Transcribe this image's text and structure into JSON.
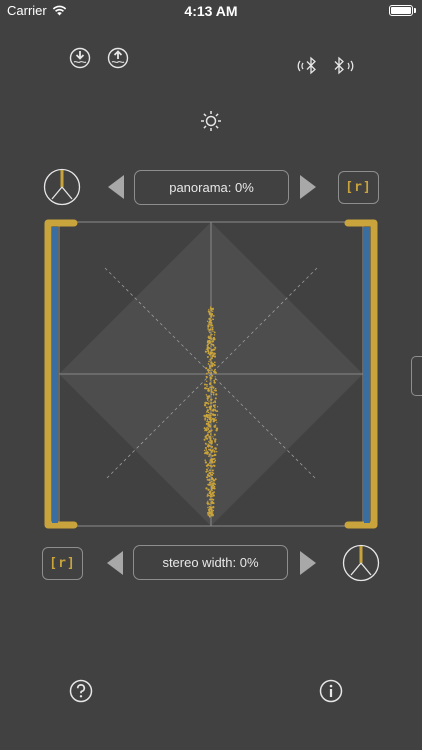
{
  "status_bar": {
    "carrier": "Carrier",
    "time": "4:13 AM",
    "battery_level": 1.0
  },
  "toolbar": {
    "download_icon": "download-icon",
    "upload_icon": "upload-icon",
    "bluetooth_left_icon": "bluetooth-left-icon",
    "bluetooth_right_icon": "bluetooth-right-icon",
    "brightness_icon": "brightness-icon"
  },
  "panorama": {
    "label": "panorama: 0%",
    "value_percent": 0,
    "reset_label": "[r]"
  },
  "stereo_width": {
    "label": "stereo width: 0%",
    "value_percent": 0,
    "reset_label": "[r]"
  },
  "meters": {
    "left_level": 1.0,
    "right_level": 1.0
  },
  "colors": {
    "accent": "#c9a33b",
    "meter_blue": "#3b6ea0",
    "background": "#414141",
    "border": "#8e8e8e"
  },
  "footer": {
    "help_icon": "help-icon",
    "info_icon": "info-icon"
  }
}
